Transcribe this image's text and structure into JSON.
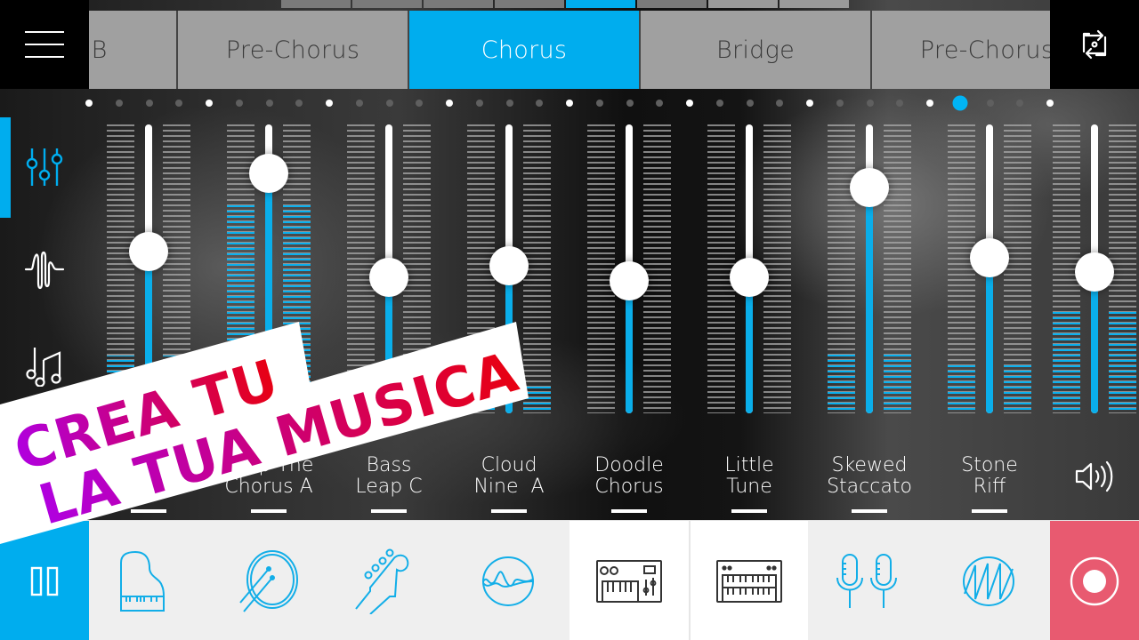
{
  "app": {
    "accent_color": "#00adee",
    "record_color": "#e85a70"
  },
  "overview": {
    "segments": 8,
    "active_index": 4
  },
  "header": {
    "menu_icon": "hamburger-menu-icon",
    "loop_icon": "loop-swap-icon",
    "tabs": [
      {
        "label": "Verse B",
        "active": false
      },
      {
        "label": "Pre-Chorus",
        "active": false
      },
      {
        "label": "Chorus",
        "active": true
      },
      {
        "label": "Bridge",
        "active": false
      },
      {
        "label": "Pre-Chorus",
        "active": false
      }
    ]
  },
  "sidebar": {
    "items": [
      {
        "name": "mixer",
        "icon": "mixer-sliders-icon",
        "active": true
      },
      {
        "name": "effects",
        "icon": "waveform-icon",
        "active": false
      },
      {
        "name": "notes",
        "icon": "music-notes-icon",
        "active": false
      }
    ]
  },
  "timeline": {
    "steps": 33,
    "beats_per_bar": 4,
    "current_step": 29
  },
  "mixer": {
    "channels": [
      {
        "label_line1": "",
        "label_line2": "",
        "volume": 0.56,
        "meter_level": 0.2
      },
      {
        "label_line1": "Leap The",
        "label_line2": "Chorus A",
        "volume": 0.83,
        "meter_level": 0.72
      },
      {
        "label_line1": "Bass",
        "label_line2": "Leap C",
        "volume": 0.47,
        "meter_level": 0.05
      },
      {
        "label_line1": "Cloud",
        "label_line2": "Nine  A",
        "volume": 0.51,
        "meter_level": 0.1
      },
      {
        "label_line1": "Doodle",
        "label_line2": "Chorus",
        "volume": 0.46,
        "meter_level": 0
      },
      {
        "label_line1": "Little",
        "label_line2": "Tune",
        "volume": 0.47,
        "meter_level": 0
      },
      {
        "label_line1": "Skewed",
        "label_line2": "Staccato",
        "volume": 0.78,
        "meter_level": 0.21
      },
      {
        "label_line1": "Stone",
        "label_line2": "Riff",
        "volume": 0.54,
        "meter_level": 0.17
      }
    ],
    "master": {
      "icon": "speaker-volume-icon",
      "volume": 0.49,
      "meter_level": 0.35
    }
  },
  "banner": {
    "line1": "CREA TU",
    "line2": "LA TUA MUSICA",
    "gradient_start": "#b000e0",
    "gradient_end": "#e80010"
  },
  "bottom_bar": {
    "play_icon": "pause-icon",
    "instruments": [
      {
        "name": "piano",
        "icon": "grand-piano-icon",
        "selected": false
      },
      {
        "name": "drums",
        "icon": "drum-icon",
        "selected": false
      },
      {
        "name": "bass",
        "icon": "bass-guitar-icon",
        "selected": false
      },
      {
        "name": "fx",
        "icon": "wave-circle-icon",
        "selected": false
      },
      {
        "name": "synth",
        "icon": "synth-keyboard-icon",
        "selected": true
      },
      {
        "name": "keys",
        "icon": "organ-keyboard-icon",
        "selected": true
      },
      {
        "name": "vocals",
        "icon": "microphones-icon",
        "selected": false
      },
      {
        "name": "lead",
        "icon": "sawtooth-wave-icon",
        "selected": false
      }
    ],
    "record_icon": "record-icon"
  }
}
